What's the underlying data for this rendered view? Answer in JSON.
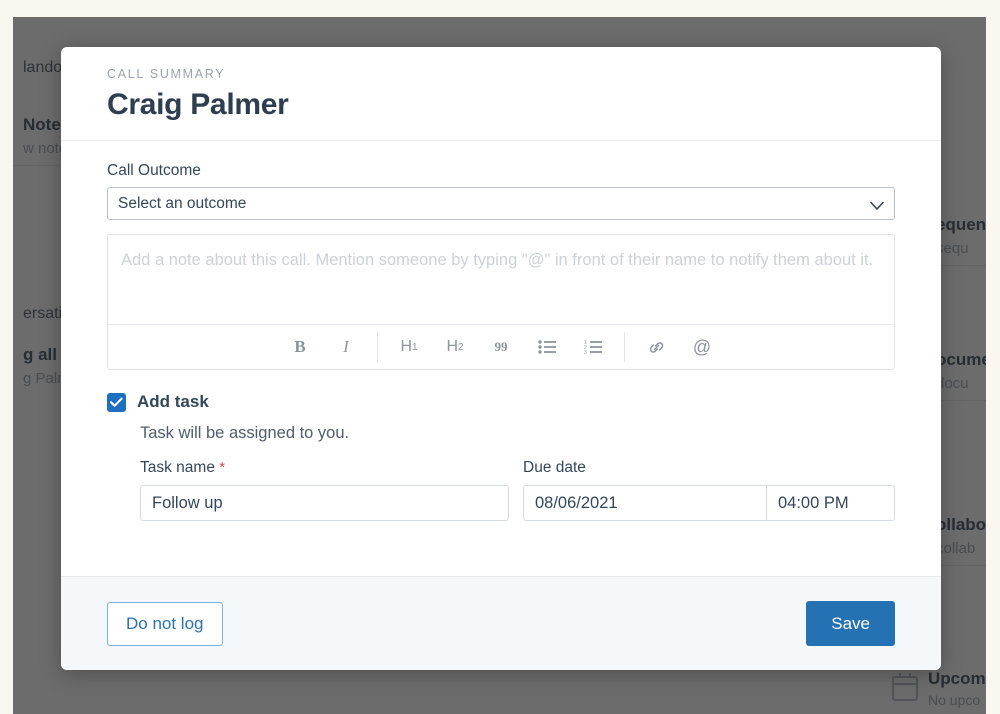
{
  "background": {
    "left_items": [
      {
        "text": "lando",
        "style": "plain"
      },
      {
        "title": "Note",
        "subtitle": "w note"
      },
      {
        "text": "ersatio",
        "style": "plain"
      },
      {
        "title": "g all a",
        "subtitle": "g Palme"
      }
    ],
    "right_items": [
      {
        "title": "equen",
        "subtitle": "sequ"
      },
      {
        "title": "ocume",
        "subtitle": "docu"
      },
      {
        "title": "ollabo",
        "subtitle": "collab"
      }
    ],
    "upcoming": {
      "icon": "calendar-icon",
      "title": "Upcomi",
      "subtitle": "No upco"
    }
  },
  "modal": {
    "eyebrow": "CALL SUMMARY",
    "title": "Craig Palmer",
    "call_outcome": {
      "label": "Call Outcome",
      "selected": "Select an outcome",
      "chevron_icon": "chevron-down-icon"
    },
    "note": {
      "placeholder": "Add a note about this call. Mention someone by typing \"@\" in front of their name to notify them about it.",
      "value": "",
      "toolbar": [
        {
          "name": "bold-button",
          "glyph": "B",
          "kind": "bold"
        },
        {
          "name": "italic-button",
          "glyph": "I",
          "kind": "ital"
        },
        {
          "name": "toolbar-separator-1",
          "glyph": "",
          "kind": "sep"
        },
        {
          "name": "heading-1-button",
          "glyph": "H",
          "sub": "1",
          "kind": "head"
        },
        {
          "name": "heading-2-button",
          "glyph": "H",
          "sub": "2",
          "kind": "head"
        },
        {
          "name": "blockquote-button",
          "glyph": "99",
          "kind": "quote"
        },
        {
          "name": "bulleted-list-button",
          "glyph": "",
          "kind": "ul"
        },
        {
          "name": "numbered-list-button",
          "glyph": "",
          "kind": "ol"
        },
        {
          "name": "toolbar-separator-2",
          "glyph": "",
          "kind": "sep"
        },
        {
          "name": "link-button",
          "glyph": "",
          "kind": "link"
        },
        {
          "name": "mention-button",
          "glyph": "@",
          "kind": "at"
        }
      ]
    },
    "task": {
      "checkbox_checked": true,
      "checkbox_icon": "checkmark-icon",
      "title": "Add task",
      "subtitle": "Task will be assigned to you.",
      "name_label": "Task name",
      "required_marker": "*",
      "name_value": "Follow up",
      "due_label": "Due date",
      "due_date_value": "08/06/2021",
      "due_time_value": "04:00 PM"
    },
    "footer": {
      "secondary_label": "Do not log",
      "primary_label": "Save"
    }
  },
  "colors": {
    "accent_blue": "#2472b4",
    "checkbox_blue": "#1f6fc0",
    "link_blue": "#2a72b5",
    "text_dark": "#33475b",
    "overlay": "rgba(32,32,32,0.66)",
    "page_bg": "#faf6f0",
    "footer_bg": "#f5f8fa",
    "required_red": "#d94f4f"
  }
}
